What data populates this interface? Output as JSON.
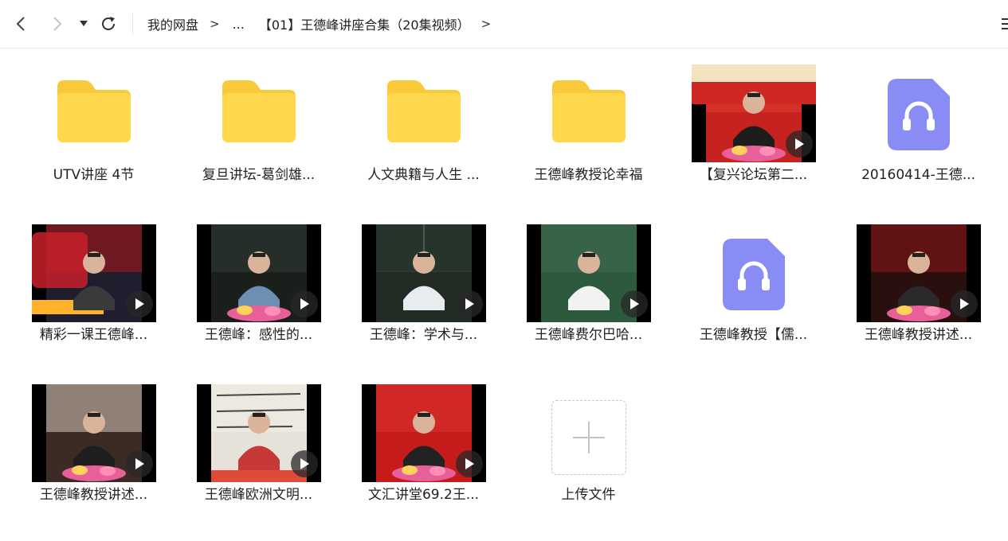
{
  "breadcrumb": {
    "root": "我的网盘",
    "ellipsis": "...",
    "current": "【01】王德峰讲座合集（20集视频）",
    "separator": ">"
  },
  "items": [
    {
      "type": "folder",
      "name": "UTV讲座 4节"
    },
    {
      "type": "folder",
      "name": "复旦讲坛-葛剑雄..."
    },
    {
      "type": "folder",
      "name": "人文典籍与人生 ..."
    },
    {
      "type": "folder",
      "name": "王德峰教授论幸福"
    },
    {
      "type": "video",
      "name": "【复兴论坛第二...",
      "scene": "red"
    },
    {
      "type": "audio",
      "name": "20160414-王德..."
    },
    {
      "type": "video",
      "name": "精彩一课王德峰...",
      "scene": "tv"
    },
    {
      "type": "video",
      "name": "王德峰：感性的...",
      "scene": "hall"
    },
    {
      "type": "video",
      "name": "王德峰：学术与...",
      "scene": "board"
    },
    {
      "type": "video",
      "name": "王德峰费尔巴哈...",
      "scene": "green"
    },
    {
      "type": "audio",
      "name": "王德峰教授【儒..."
    },
    {
      "type": "video",
      "name": "王德峰教授讲述...",
      "scene": "stage"
    },
    {
      "type": "video",
      "name": "王德峰教授讲述...",
      "scene": "podium"
    },
    {
      "type": "video",
      "name": "王德峰欧洲文明...",
      "scene": "paper"
    },
    {
      "type": "video",
      "name": "文汇讲堂69.2王...",
      "scene": "redwall"
    },
    {
      "type": "upload",
      "name": "上传文件"
    }
  ],
  "colors": {
    "folder_back": "#f9c93a",
    "folder_front": "#ffd84d",
    "audio_bg": "#8a8cf5",
    "text": "#222222",
    "icon": "#555555"
  }
}
